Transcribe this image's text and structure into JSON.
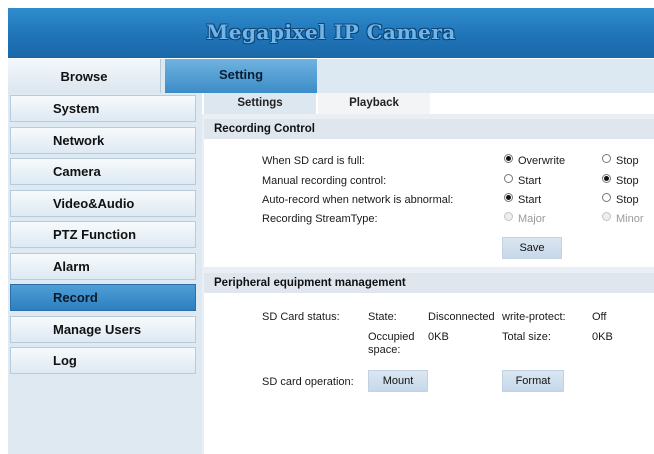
{
  "banner": {
    "title": "Megapixel IP Camera"
  },
  "topnav": {
    "browse": "Browse",
    "setting": "Setting"
  },
  "sidebar": {
    "items": [
      {
        "label": "System"
      },
      {
        "label": "Network"
      },
      {
        "label": "Camera"
      },
      {
        "label": "Video&Audio"
      },
      {
        "label": "PTZ Function"
      },
      {
        "label": "Alarm"
      },
      {
        "label": "Record",
        "active": true
      },
      {
        "label": "Manage Users"
      },
      {
        "label": "Log"
      }
    ]
  },
  "subtabs": {
    "settings": "Settings",
    "playback": "Playback"
  },
  "recording_control": {
    "heading": "Recording Control",
    "sd_full": {
      "label": "When SD card is full:",
      "opt1": "Overwrite",
      "opt2": "Stop",
      "selected": "Overwrite"
    },
    "manual": {
      "label": "Manual recording control:",
      "opt1": "Start",
      "opt2": "Stop",
      "selected": "Stop"
    },
    "auto_record": {
      "label": "Auto-record when network is abnormal:",
      "opt1": "Start",
      "opt2": "Stop",
      "selected": "Start"
    },
    "stream_type": {
      "label": "Recording StreamType:",
      "opt1": "Major",
      "opt2": "Minor",
      "disabled": true
    },
    "save_label": "Save"
  },
  "peripheral": {
    "heading": "Peripheral equipment management",
    "sd_status_label": "SD Card status:",
    "state_label": "State:",
    "state_value": "Disconnected",
    "write_protect_label": "write-protect:",
    "write_protect_value": "Off",
    "occupied_label_1": "Occupied",
    "occupied_label_2": "space:",
    "occupied_value": "0KB",
    "total_label": "Total size:",
    "total_value": "0KB",
    "operation_label": "SD card operation:",
    "mount_label": "Mount",
    "format_label": "Format"
  }
}
